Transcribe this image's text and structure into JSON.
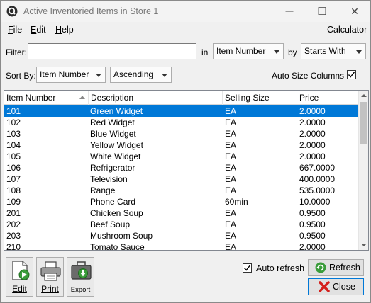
{
  "window": {
    "title": "Active Inventoried Items in Store 1",
    "minimize_glyph": "—",
    "maximize_glyph": "☐",
    "close_glyph": "✕"
  },
  "menu": {
    "file": "File",
    "edit": "Edit",
    "help": "Help",
    "calculator": "Calculator"
  },
  "filter": {
    "label": "Filter:",
    "value": "",
    "in_label": "in",
    "field_selected": "Item Number",
    "by_label": "by",
    "match_selected": "Starts With"
  },
  "sort": {
    "label": "Sort By:",
    "field_selected": "Item Number",
    "order_selected": "Ascending",
    "autosize_label": "Auto Size Columns",
    "autosize_checked": true
  },
  "grid": {
    "columns": [
      "Item Number",
      "Description",
      "Selling Size",
      "Price"
    ],
    "selected_index": 0,
    "rows": [
      [
        "101",
        "Green Widget",
        "EA",
        "2.0000"
      ],
      [
        "102",
        "Red Widget",
        "EA",
        "2.0000"
      ],
      [
        "103",
        "Blue Widget",
        "EA",
        "2.0000"
      ],
      [
        "104",
        "Yellow Widget",
        "EA",
        "2.0000"
      ],
      [
        "105",
        "White Widget",
        "EA",
        "2.0000"
      ],
      [
        "106",
        "Refrigerator",
        "EA",
        "667.0000"
      ],
      [
        "107",
        "Television",
        "EA",
        "400.0000"
      ],
      [
        "108",
        "Range",
        "EA",
        "535.0000"
      ],
      [
        "109",
        "Phone Card",
        "60min",
        "10.0000"
      ],
      [
        "201",
        "Chicken Soup",
        "EA",
        "0.9500"
      ],
      [
        "202",
        "Beef Soup",
        "EA",
        "0.9500"
      ],
      [
        "203",
        "Mushroom Soup",
        "EA",
        "0.9500"
      ],
      [
        "210",
        "Tomato Sauce",
        "EA",
        "2.0000"
      ]
    ]
  },
  "bottom": {
    "edit_label": "Edit",
    "print_label": "Print",
    "export_label": "Export",
    "auto_refresh_label": "Auto refresh",
    "auto_refresh_checked": true,
    "refresh_label": "Refresh",
    "close_label": "Close"
  },
  "colors": {
    "selection": "#0078d7",
    "accent": "#0078d7"
  }
}
